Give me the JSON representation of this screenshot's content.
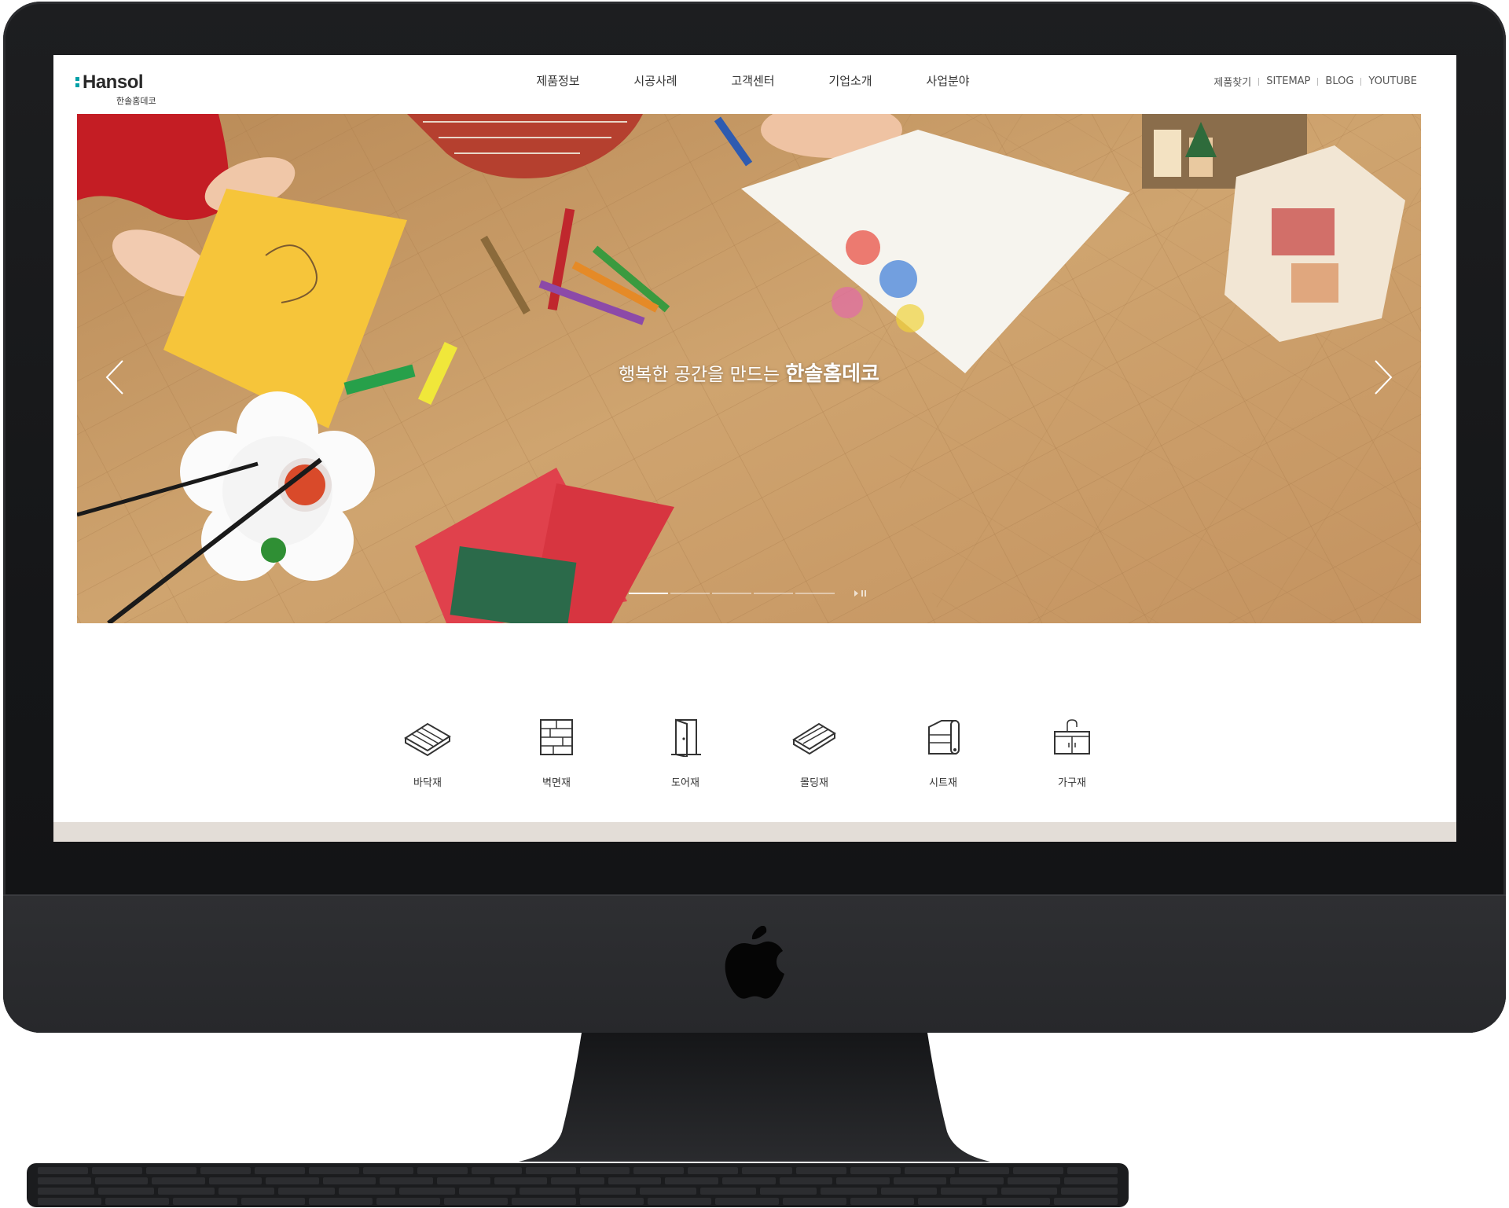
{
  "brand": {
    "name": "Hansol",
    "sub": "한솔홈데코"
  },
  "nav": {
    "items": [
      "제품정보",
      "시공사례",
      "고객센터",
      "기업소개",
      "사업분야"
    ]
  },
  "util": [
    "제품찾기",
    "SITEMAP",
    "BLOG",
    "YOUTUBE"
  ],
  "hero": {
    "tagline_light": "행복한 공간을 만드는 ",
    "tagline_strong": "한솔홈데코",
    "slides_total": 5,
    "active_slide": 1
  },
  "categories": [
    {
      "label": "바닥재",
      "icon": "floor-icon"
    },
    {
      "label": "벽면재",
      "icon": "wall-icon"
    },
    {
      "label": "도어재",
      "icon": "door-icon"
    },
    {
      "label": "몰딩재",
      "icon": "molding-icon"
    },
    {
      "label": "시트재",
      "icon": "sheet-icon"
    },
    {
      "label": "가구재",
      "icon": "furniture-icon"
    }
  ],
  "colors": {
    "accent": "#00a0a8",
    "band": "#e3ddd7",
    "wood": "#c79a64"
  }
}
